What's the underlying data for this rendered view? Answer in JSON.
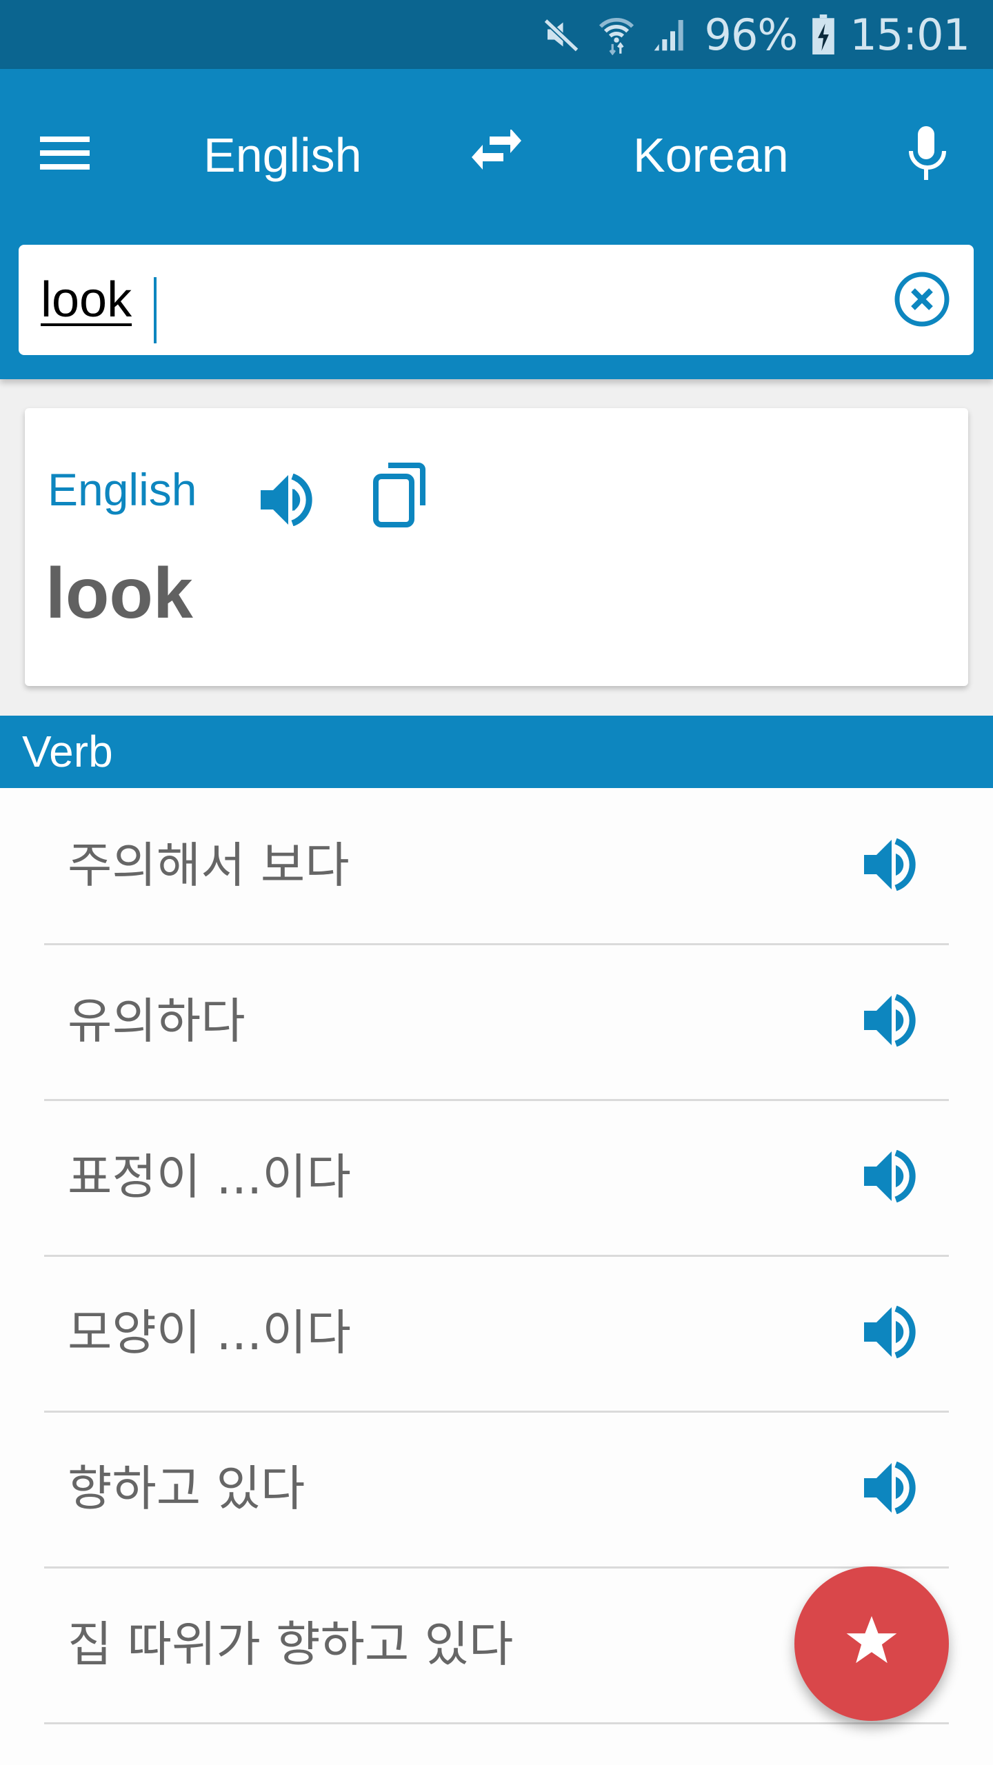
{
  "status_bar": {
    "icons": [
      "mute-icon",
      "wifi-icon",
      "signal-icon",
      "battery-charging-icon"
    ],
    "battery_percent": "96%",
    "time": "15:01"
  },
  "toolbar": {
    "menu_icon": "hamburger-menu-icon",
    "source_language": "English",
    "swap_icon": "swap-arrows-icon",
    "target_language": "Korean",
    "mic_icon": "microphone-icon"
  },
  "search": {
    "value": "look",
    "placeholder": "",
    "clear_icon": "clear-circle-x-icon"
  },
  "source_card": {
    "language": "English",
    "speaker_icon": "speaker-icon",
    "copy_icon": "copy-icon",
    "word": "look"
  },
  "section": {
    "title": "Verb"
  },
  "translations": [
    {
      "text": "주의해서 보다",
      "icon": "speaker-icon"
    },
    {
      "text": "유의하다",
      "icon": "speaker-icon"
    },
    {
      "text": "표정이 ...이다",
      "icon": "speaker-icon"
    },
    {
      "text": "모양이 ...이다",
      "icon": "speaker-icon"
    },
    {
      "text": "향하고 있다",
      "icon": "speaker-icon"
    },
    {
      "text": "집 따위가 향하고 있다",
      "icon": "speaker-icon"
    }
  ],
  "fab": {
    "icon": "star-icon"
  },
  "colors": {
    "status_bar": "#0b6590",
    "primary": "#0d86bf",
    "fab": "#d9474a",
    "text_secondary": "#666666"
  }
}
